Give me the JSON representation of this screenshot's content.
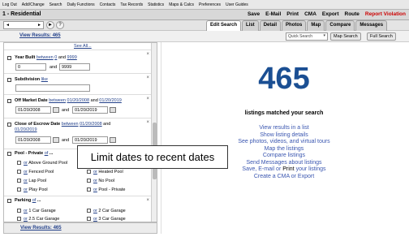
{
  "top_menu": [
    "Log Out",
    "Add/Change",
    "Search",
    "Daily Functions",
    "Contacts",
    "Tax Records",
    "Statistics",
    "Maps & Calcs",
    "Preferences",
    "User Guides"
  ],
  "title": "1 - Residential",
  "actions": {
    "save": "Save",
    "email": "E-Mail",
    "print": "Print",
    "cma": "CMA",
    "export": "Export",
    "route": "Route",
    "report": "Report Violation"
  },
  "nav_icons": {
    "back": "◄",
    "forward": "►",
    "help": "?"
  },
  "tabs": [
    "Edit Search",
    "List",
    "Detail",
    "Photos",
    "Map",
    "Compare",
    "Messages"
  ],
  "subbar": {
    "view_results": "View Results: 465",
    "quick_search": "Quick Search",
    "map_search": "Map Search",
    "full_search": "Full Search"
  },
  "left": {
    "see_all": "See All...",
    "year_built": {
      "label": "Year Built",
      "between": "between",
      "x": "0",
      "and": "and",
      "y": "9999",
      "from": "0",
      "to": "9999"
    },
    "subdivision": {
      "label": "Subdivision",
      "like": "like"
    },
    "off_market": {
      "label": "Off Market Date",
      "between": "between",
      "x": "01/20/2008",
      "and": "and",
      "y": "01/20/2019",
      "from": "01/20/2008",
      "to": "01/20/2019"
    },
    "close_escrow": {
      "label": "Close of Escrow Date",
      "between": "between",
      "x": "01/20/2008",
      "and": "and",
      "y": "01/20/2019",
      "from": "01/20/2008",
      "to": "01/20/2019"
    },
    "pool": {
      "label": "Pool - Private",
      "of": "of",
      "opts": [
        "Above Ground Pool",
        "Fenced Pool",
        "Lap Pool",
        "Play Pool",
        "Heated Pool",
        "No Pool",
        "Pool - Private"
      ]
    },
    "parking": {
      "label": "Parking",
      "of": "of",
      "opts": [
        "1 Car Garage",
        "2.5 Car Garage",
        "2 Car Garage",
        "3 Car Garage"
      ]
    },
    "or": "or"
  },
  "footer": {
    "view_results": "View Results: 465"
  },
  "right": {
    "count": "465",
    "matched": "listings matched your search",
    "links": [
      "View results in a list",
      "Show listing details",
      "See photos, videos, and virtual tours",
      "Map the listings",
      "Compare listings",
      "Send Messages about listings"
    ],
    "save_line": {
      "a": "Save, E-mail or",
      "print": "Print",
      "b": "your listings"
    },
    "cma_line": {
      "a": "Create a CMA or",
      "export": "Export"
    }
  },
  "tooltip": "Limit dates to recent dates"
}
